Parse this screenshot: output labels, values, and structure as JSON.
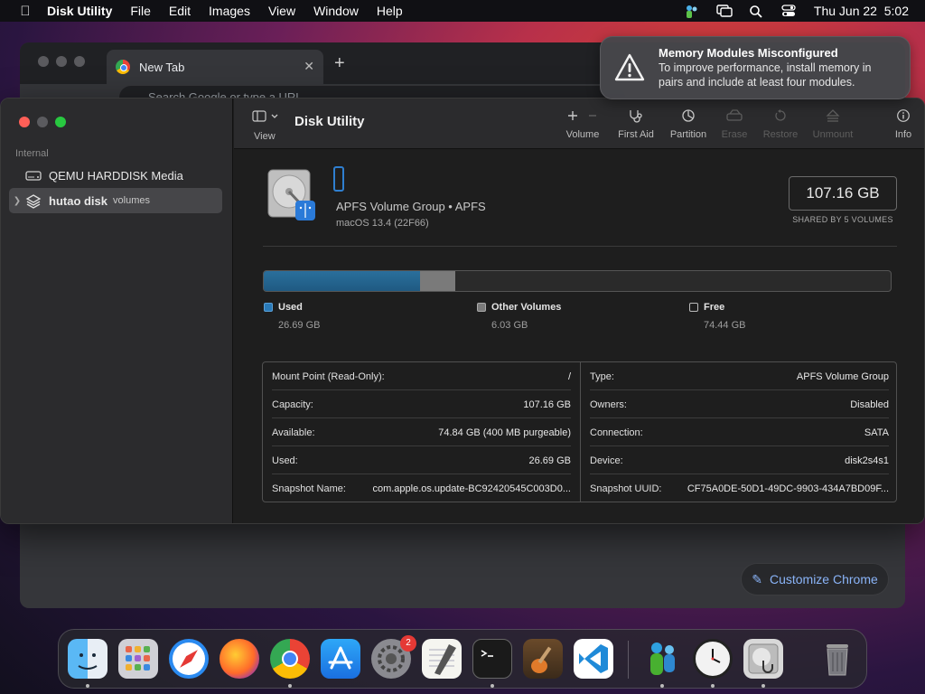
{
  "menubar": {
    "app_name": "Disk Utility",
    "menus": [
      "File",
      "Edit",
      "Images",
      "View",
      "Window",
      "Help"
    ],
    "clock": "Thu Jun 22  5:02"
  },
  "chrome": {
    "tab_title": "New Tab",
    "omnibox_placeholder": "Search Google or type a URL",
    "customize_label": "Customize Chrome"
  },
  "notification": {
    "title": "Memory Modules Misconfigured",
    "body": "To improve performance, install memory in pairs and include at least four modules."
  },
  "sidebar": {
    "section_label": "Internal",
    "items": [
      {
        "label": "QEMU HARDDISK Media",
        "sub": ""
      },
      {
        "label": "hutao disk",
        "sub": "volumes"
      }
    ]
  },
  "toolbar": {
    "view_label": "View",
    "title": "Disk Utility",
    "buttons": [
      {
        "label": "Volume",
        "enabled": true
      },
      {
        "label": "First Aid",
        "enabled": true
      },
      {
        "label": "Partition",
        "enabled": true
      },
      {
        "label": "Erase",
        "enabled": false
      },
      {
        "label": "Restore",
        "enabled": false
      },
      {
        "label": "Unmount",
        "enabled": false
      },
      {
        "label": "Info",
        "enabled": true
      }
    ]
  },
  "volume": {
    "type": "APFS Volume Group • APFS",
    "os": "macOS 13.4 (22F66)",
    "size": "107.16 GB",
    "shared_label": "SHARED BY 5 VOLUMES"
  },
  "usage": {
    "total_gb": 107.16,
    "segments": [
      {
        "name": "Used",
        "value": "26.69 GB",
        "gb": 26.69,
        "color": "#1f5a82"
      },
      {
        "name": "Other Volumes",
        "value": "6.03 GB",
        "gb": 6.03,
        "color": "#7a7a7a"
      },
      {
        "name": "Free",
        "value": "74.44 GB",
        "gb": 74.44,
        "color": "#2a2a2a"
      }
    ]
  },
  "info": {
    "left": [
      {
        "key": "Mount Point (Read-Only):",
        "value": "/"
      },
      {
        "key": "Capacity:",
        "value": "107.16 GB"
      },
      {
        "key": "Available:",
        "value": "74.84 GB (400 MB purgeable)"
      },
      {
        "key": "Used:",
        "value": "26.69 GB"
      },
      {
        "key": "Snapshot Name:",
        "value": "com.apple.os.update-BC92420545C003D0..."
      }
    ],
    "right": [
      {
        "key": "Type:",
        "value": "APFS Volume Group"
      },
      {
        "key": "Owners:",
        "value": "Disabled"
      },
      {
        "key": "Connection:",
        "value": "SATA"
      },
      {
        "key": "Device:",
        "value": "disk2s4s1"
      },
      {
        "key": "Snapshot UUID:",
        "value": "CF75A0DE-50D1-49DC-9903-434A7BD09F..."
      }
    ]
  },
  "dock": {
    "apps": [
      "finder-icon",
      "launchpad-icon",
      "safari-icon",
      "firefox-icon",
      "chrome-icon",
      "app-store-icon",
      "system-settings-icon",
      "textedit-icon",
      "terminal-icon",
      "garageband-icon",
      "vscode-icon",
      "messenger-icon",
      "clock-icon",
      "disk-utility-icon",
      "trash-icon"
    ],
    "settings_badge": "2"
  }
}
